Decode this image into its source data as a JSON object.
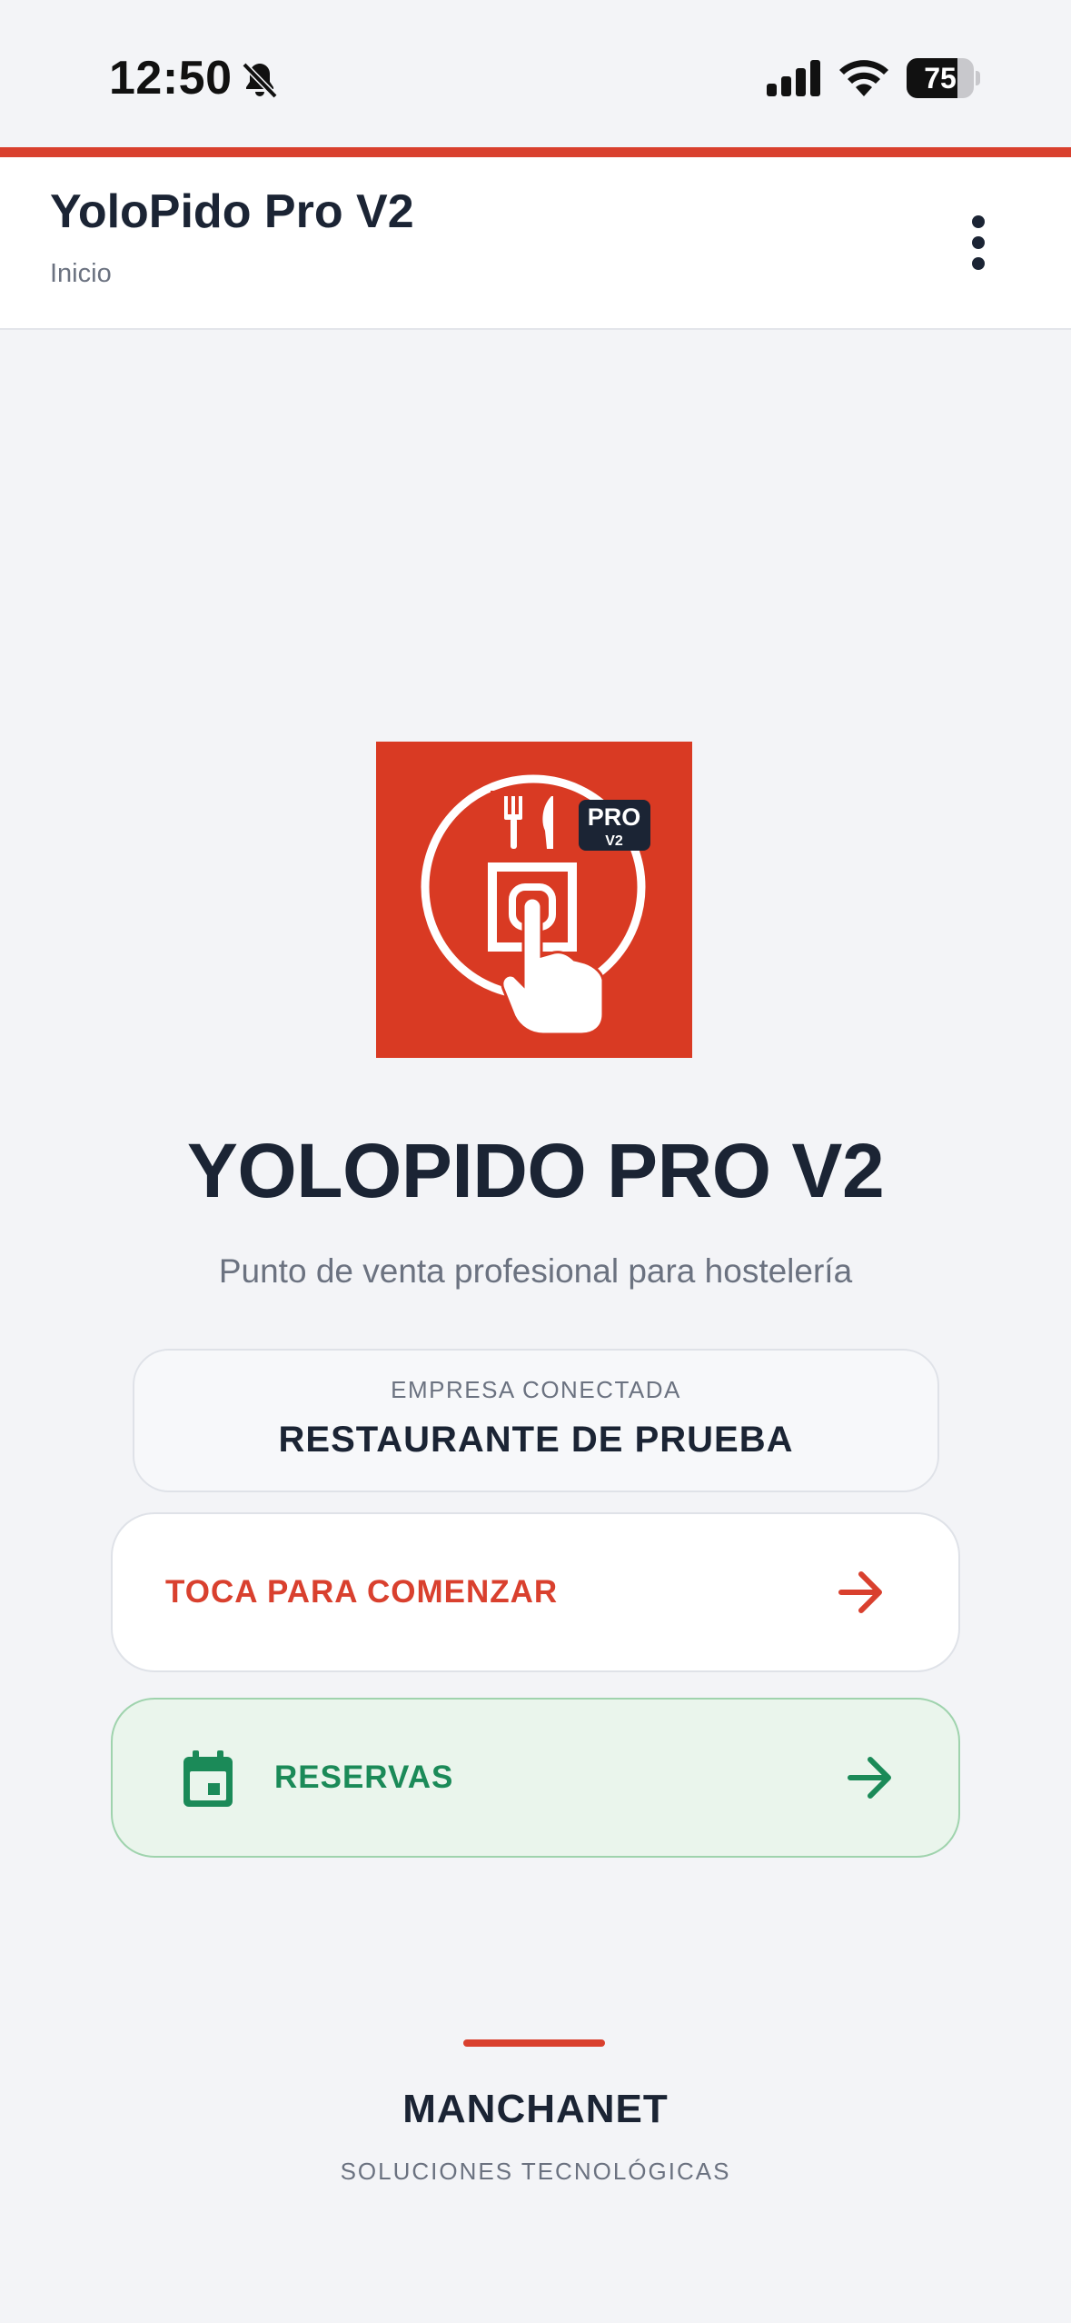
{
  "status_bar": {
    "time": "12:50",
    "battery_percent": 75,
    "battery_label": "75"
  },
  "header": {
    "title": "YoloPido Pro V2",
    "subtitle": "Inicio",
    "menu_icon": "more-vertical-icon"
  },
  "logo": {
    "badge_top": "PRO",
    "badge_bottom": "V2",
    "tile_color": "#d93a23"
  },
  "hero": {
    "title": "YOLOPIDO PRO V2",
    "tagline": "Punto de venta profesional para hostelería"
  },
  "company": {
    "label": "EMPRESA CONECTADA",
    "name": "RESTAURANTE DE PRUEBA"
  },
  "actions": {
    "start_label": "TOCA PARA COMENZAR",
    "reservas_label": "RESERVAS",
    "start_color": "#d9402e",
    "reservas_color": "#1b8a58"
  },
  "footer": {
    "brand": "MANCHANET",
    "tagline": "SOLUCIONES TECNOLÓGICAS"
  }
}
